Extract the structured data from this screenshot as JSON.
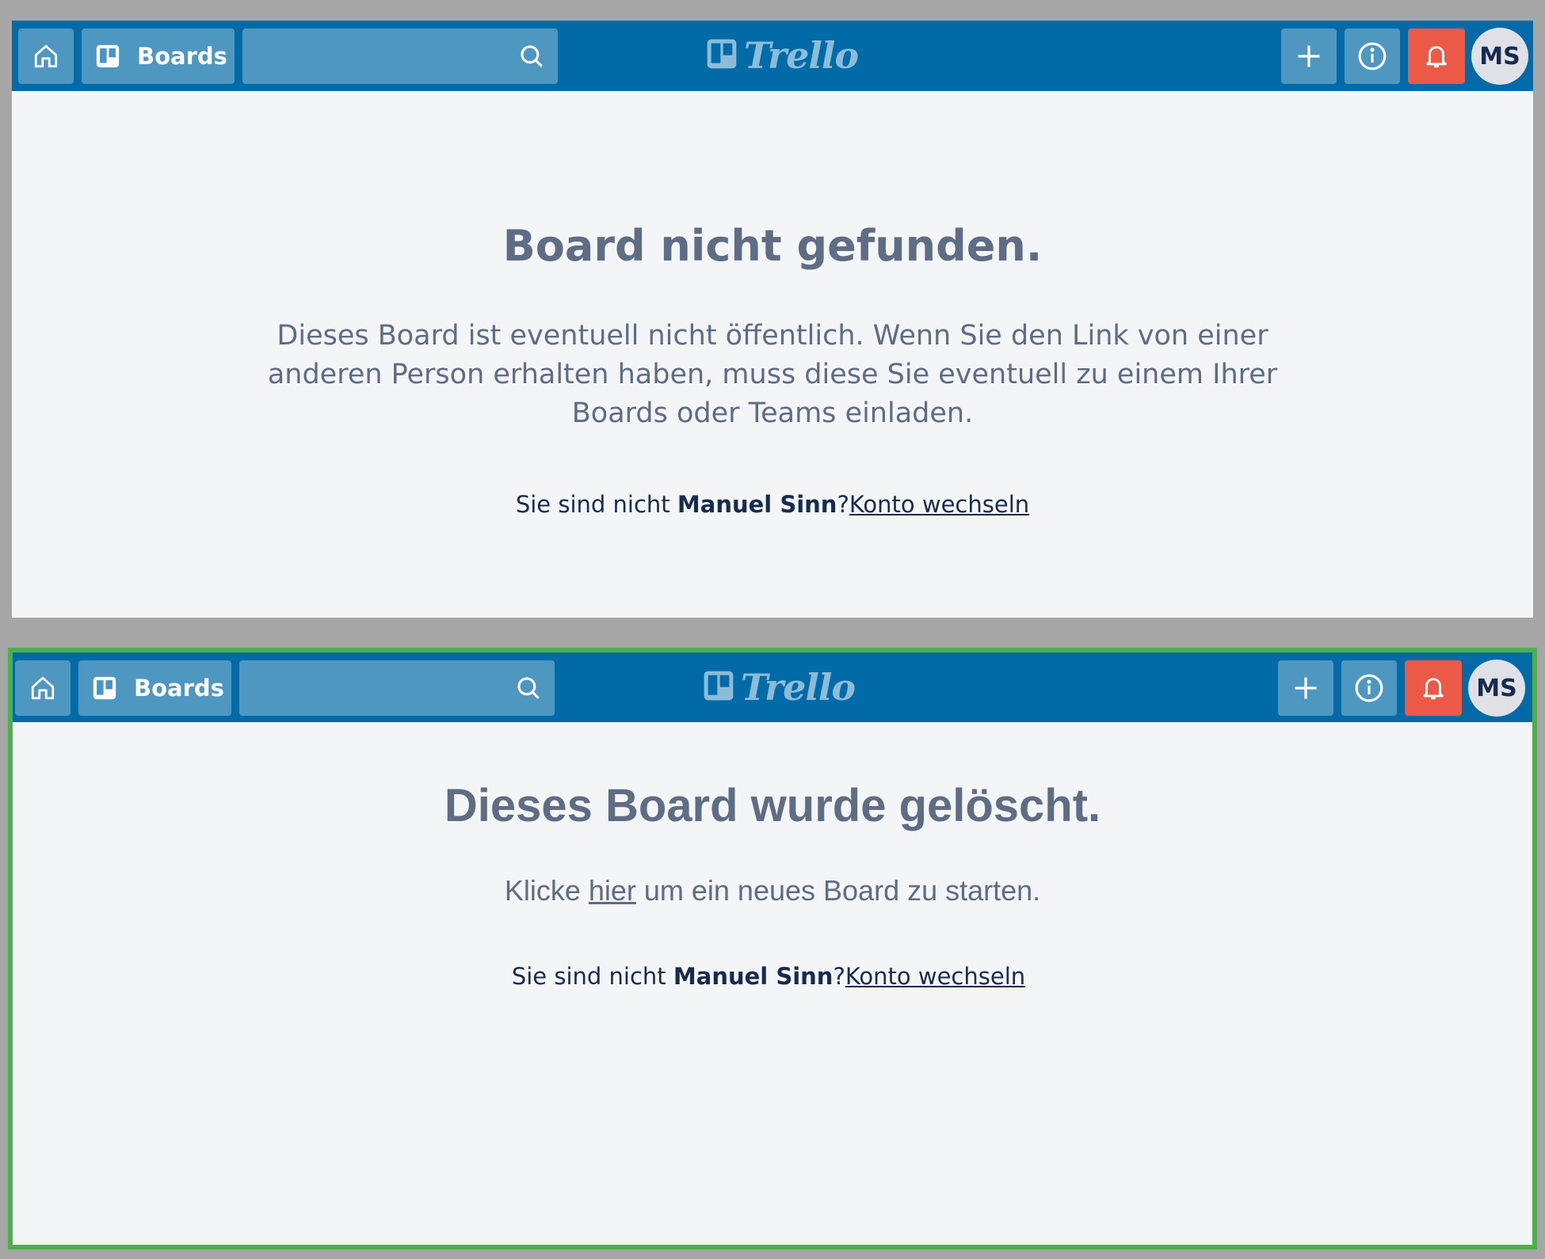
{
  "panels": [
    {
      "header": {
        "home_icon": "home-icon",
        "boards_label": "Boards",
        "search_placeholder": "",
        "logo_text": "Trello",
        "avatar_initials": "MS"
      },
      "title": "Board nicht gefunden.",
      "description": "Dieses Board ist eventuell nicht öffentlich. Wenn Sie den Link von einer anderen Person erhalten haben, muss diese Sie eventuell zu einem Ihrer Boards oder Teams einladen.",
      "switch_prefix": "Sie sind nicht ",
      "user_name": "Manuel Sinn",
      "switch_suffix": "?",
      "switch_link": "Konto wechseln"
    },
    {
      "header": {
        "home_icon": "home-icon",
        "boards_label": "Boards",
        "search_placeholder": "",
        "logo_text": "Trello",
        "avatar_initials": "MS"
      },
      "title": "Dieses Board wurde gelöscht.",
      "desc_prefix": "Klicke ",
      "desc_link": "hier",
      "desc_suffix": " um ein neues Board zu starten.",
      "switch_prefix": "Sie sind nicht ",
      "user_name": "Manuel Sinn",
      "switch_suffix": "?",
      "switch_link": "Konto wechseln"
    }
  ],
  "colors": {
    "header_bg": "#026aa7",
    "page_bg": "#f4f5f7",
    "notification_red": "#eb5a46",
    "highlight_border": "#4cb04f",
    "text_muted": "#5e6c84",
    "text_dark": "#172b4d"
  }
}
